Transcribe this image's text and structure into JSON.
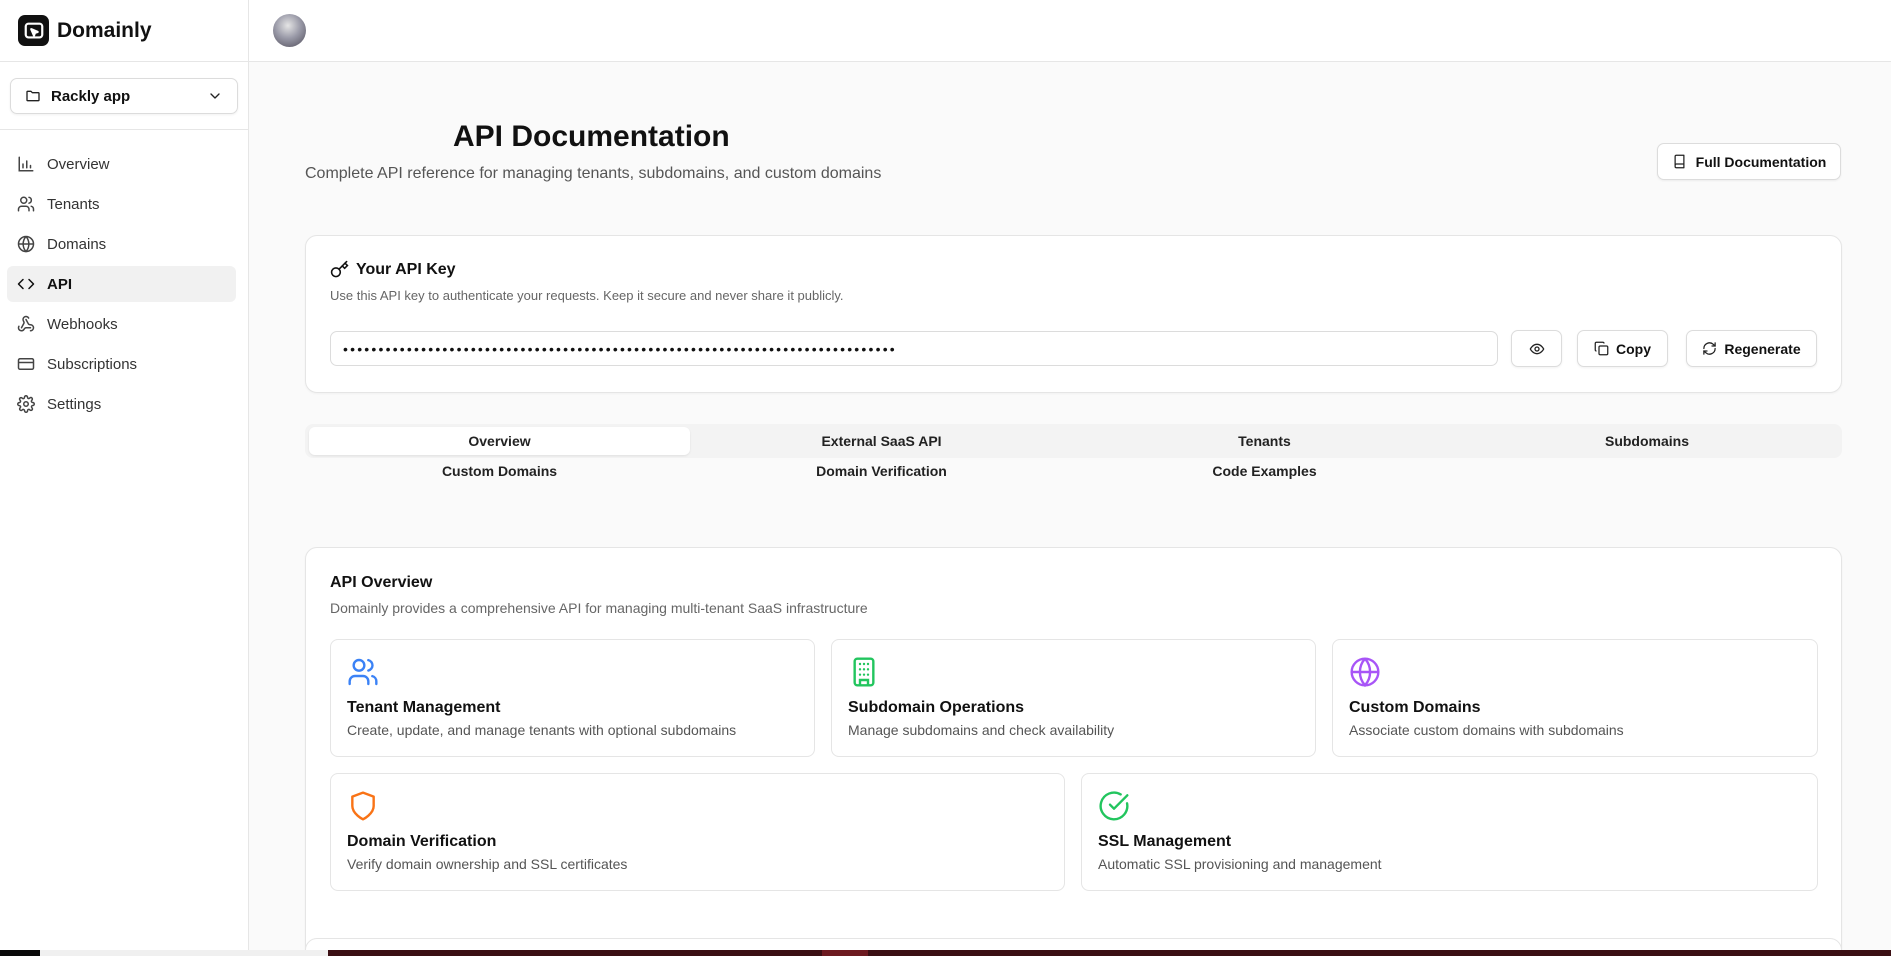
{
  "brand": {
    "name": "Domainly"
  },
  "project_switcher": {
    "label": "Rackly app"
  },
  "sidebar": {
    "items": [
      {
        "label": "Overview",
        "icon": "bar-chart-icon",
        "active": false
      },
      {
        "label": "Tenants",
        "icon": "users-icon",
        "active": false
      },
      {
        "label": "Domains",
        "icon": "globe-icon",
        "active": false
      },
      {
        "label": "API",
        "icon": "code-icon",
        "active": true
      },
      {
        "label": "Webhooks",
        "icon": "webhook-icon",
        "active": false
      },
      {
        "label": "Subscriptions",
        "icon": "credit-card-icon",
        "active": false
      },
      {
        "label": "Settings",
        "icon": "gear-icon",
        "active": false
      }
    ]
  },
  "header": {
    "title": "API Documentation",
    "subtitle": "Complete API reference for managing tenants, subdomains, and custom domains",
    "full_doc_label": "Full Documentation"
  },
  "api_key": {
    "title": "Your API Key",
    "description": "Use this API key to authenticate your requests. Keep it secure and never share it publicly.",
    "masked_value": "••••••••••••••••••••••••••••••••••••••••••••••••••••••••••••••••••••••••••••••",
    "copy_label": "Copy",
    "regenerate_label": "Regenerate"
  },
  "tabs": [
    {
      "label": "Overview",
      "active": true
    },
    {
      "label": "External SaaS API",
      "active": false
    },
    {
      "label": "Tenants",
      "active": false
    },
    {
      "label": "Subdomains",
      "active": false
    },
    {
      "label": "Custom Domains",
      "active": false
    },
    {
      "label": "Domain Verification",
      "active": false
    },
    {
      "label": "Code Examples",
      "active": false
    }
  ],
  "overview": {
    "title": "API Overview",
    "description": "Domainly provides a comprehensive API for managing multi-tenant SaaS infrastructure",
    "features": [
      {
        "title": "Tenant Management",
        "description": "Create, update, and manage tenants with optional subdomains",
        "icon": "users-icon",
        "color": "#3b82f6"
      },
      {
        "title": "Subdomain Operations",
        "description": "Manage subdomains and check availability",
        "icon": "building-icon",
        "color": "#22c55e"
      },
      {
        "title": "Custom Domains",
        "description": "Associate custom domains with subdomains",
        "icon": "globe-icon",
        "color": "#a855f7"
      },
      {
        "title": "Domain Verification",
        "description": "Verify domain ownership and SSL certificates",
        "icon": "shield-icon",
        "color": "#f97316"
      },
      {
        "title": "SSL Management",
        "description": "Automatic SSL provisioning and management",
        "icon": "check-circle-icon",
        "color": "#22c55e"
      }
    ]
  }
}
